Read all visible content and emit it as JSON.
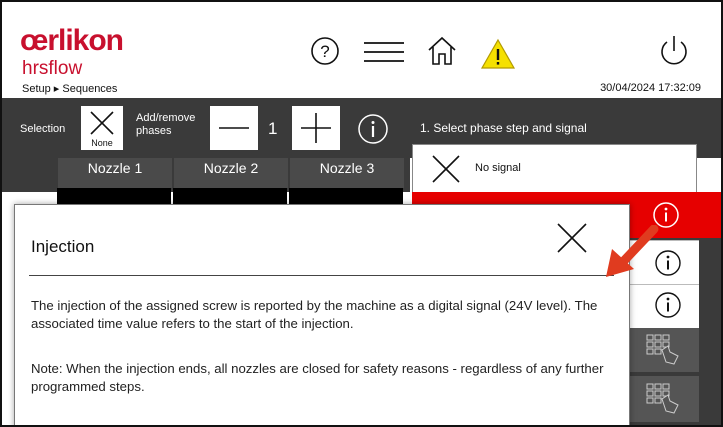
{
  "header": {
    "brand": "œrlikon",
    "brand_sub": "hrsflow",
    "breadcrumb": "Setup ▸ Sequences",
    "datetime": "30/04/2024 17:32:09",
    "icons": [
      "help-icon",
      "menu-icon",
      "home-icon",
      "warning-icon",
      "power-icon"
    ],
    "warning_color": "#f5e000"
  },
  "toolbar": {
    "selection_label": "Selection",
    "none_label": "None",
    "add_remove_label": "Add/remove\nphases",
    "phase_count": "1"
  },
  "nozzles": [
    "Nozzle 1",
    "Nozzle 2",
    "Nozzle 3"
  ],
  "right_panel": {
    "title": "1. Select phase step and signal",
    "no_signal_label": "No signal",
    "selected_row_color": "#e60000"
  },
  "popup": {
    "title": "Injection",
    "paragraph1": "The injection of the assigned screw is reported by the machine as a digital signal (24V level). The associated time value refers to the start of the injection.",
    "paragraph2": "Note: When the injection ends, all nozzles are closed for safety reasons - regardless of any further programmed steps."
  },
  "colors": {
    "brand": "#c8102e",
    "dark_panel": "#3a3a3a",
    "annotation_arrow": "#e03b1f"
  }
}
